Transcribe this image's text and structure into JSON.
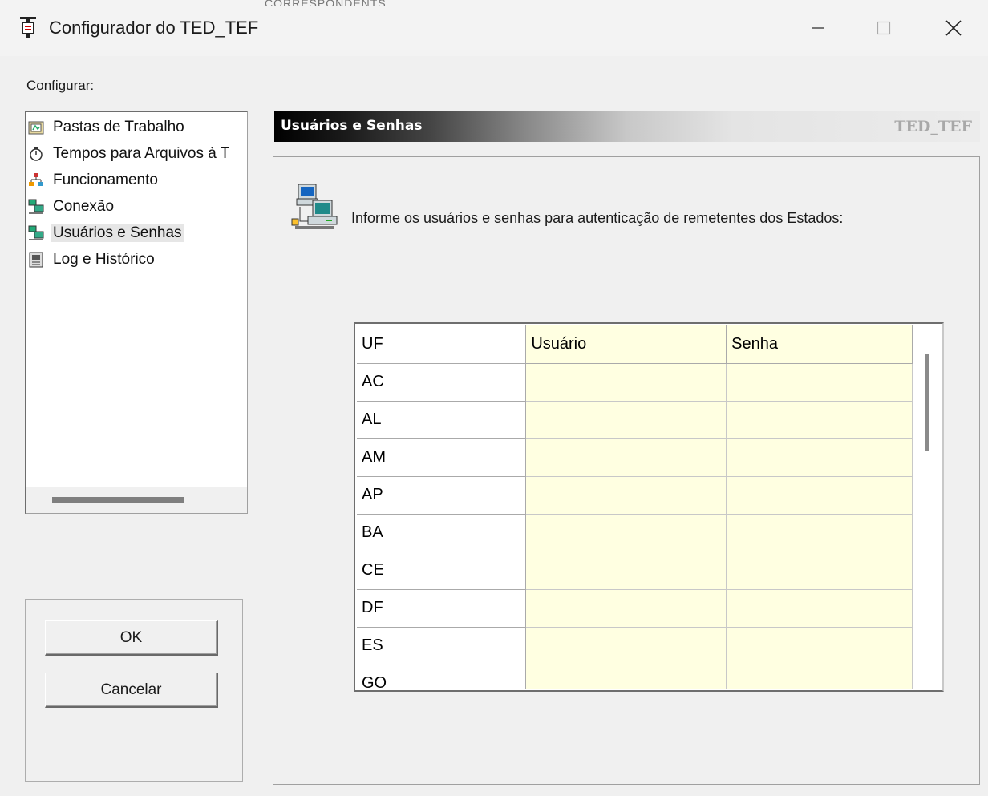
{
  "window": {
    "title": "Configurador do TED_TEF",
    "background_strip": "CORRESPONDENTS",
    "minimize_icon": "minimize-icon",
    "maximize_icon": "maximize-icon",
    "close_icon": "close-icon"
  },
  "sidebar": {
    "label": "Configurar:",
    "items": [
      {
        "label": "Pastas de Trabalho",
        "icon": "folder-icon"
      },
      {
        "label": "Tempos para Arquivos à T",
        "icon": "stopwatch-icon"
      },
      {
        "label": "Funcionamento",
        "icon": "network-tree-icon"
      },
      {
        "label": "Conexão",
        "icon": "computers-icon"
      },
      {
        "label": "Usuários e Senhas",
        "icon": "computers-icon",
        "selected": true
      },
      {
        "label": "Log e Histórico",
        "icon": "log-book-icon"
      }
    ]
  },
  "buttons": {
    "ok": "OK",
    "cancel": "Cancelar"
  },
  "section": {
    "title": "Usuários e Senhas",
    "brand": "TED_TEF",
    "instruction": "Informe os usuários e senhas para autenticação de remetentes dos Estados:"
  },
  "grid": {
    "columns": [
      "UF",
      "Usuário",
      "Senha"
    ],
    "rows": [
      {
        "uf": "AC",
        "usuario": "",
        "senha": ""
      },
      {
        "uf": "AL",
        "usuario": "",
        "senha": ""
      },
      {
        "uf": "AM",
        "usuario": "",
        "senha": ""
      },
      {
        "uf": "AP",
        "usuario": "",
        "senha": ""
      },
      {
        "uf": "BA",
        "usuario": "",
        "senha": ""
      },
      {
        "uf": "CE",
        "usuario": "",
        "senha": ""
      },
      {
        "uf": "DF",
        "usuario": "",
        "senha": ""
      },
      {
        "uf": "ES",
        "usuario": "",
        "senha": ""
      },
      {
        "uf": "GO",
        "usuario": "",
        "senha": ""
      }
    ]
  },
  "colors": {
    "editable_cell": "#ffffe1",
    "window_bg": "#f0f0f0"
  }
}
